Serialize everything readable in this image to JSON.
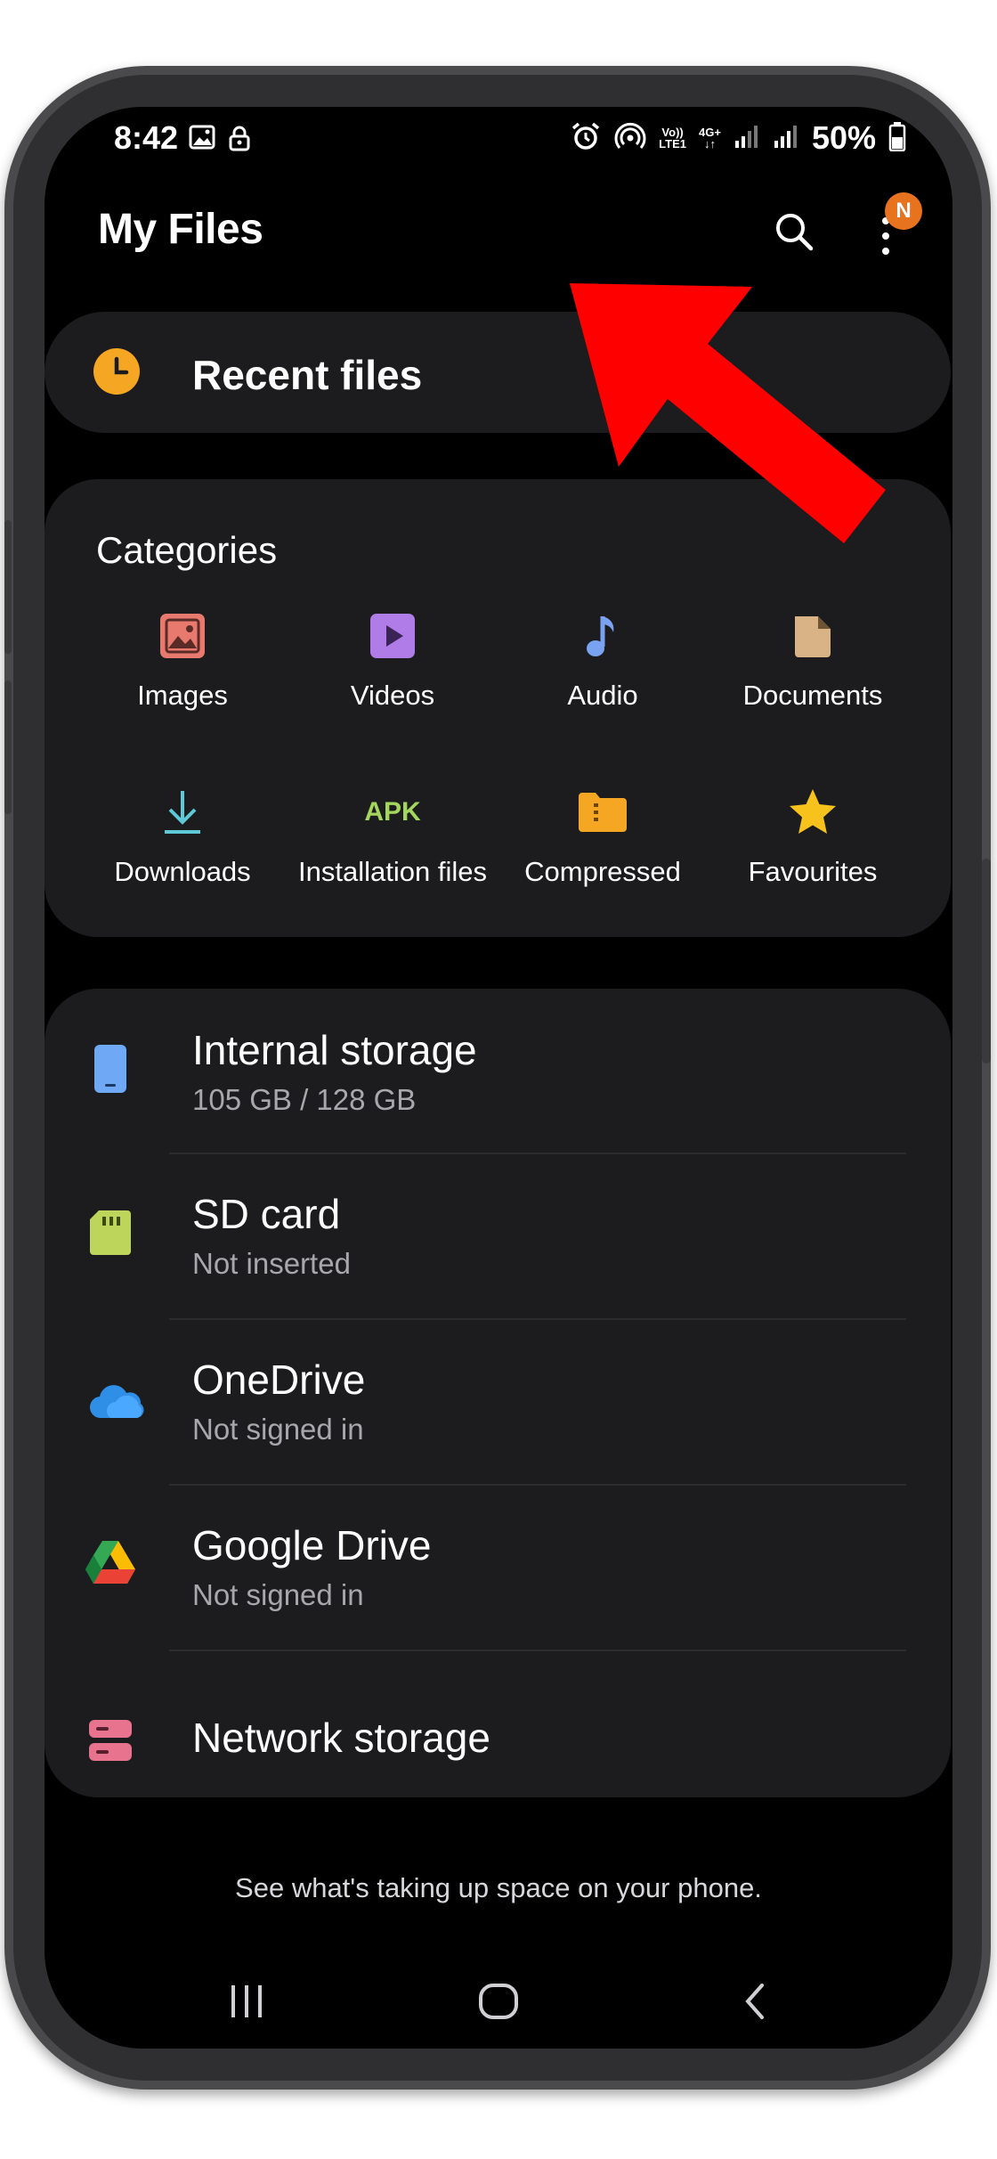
{
  "status_bar": {
    "time": "8:42",
    "battery": "50%",
    "volte_top": "Vo))",
    "volte_bottom": "LTE1",
    "net_top": "4G+",
    "net_bottom": "↓↑"
  },
  "header": {
    "title": "My Files",
    "badge": "N"
  },
  "recent": {
    "label": "Recent files"
  },
  "categories": {
    "title": "Categories",
    "items": [
      {
        "label": "Images",
        "icon": "image-icon",
        "color": "#e8796f"
      },
      {
        "label": "Videos",
        "icon": "video-icon",
        "color": "#b07ce8"
      },
      {
        "label": "Audio",
        "icon": "music-note-icon",
        "color": "#7aa2f2"
      },
      {
        "label": "Documents",
        "icon": "document-icon",
        "color": "#d9b386"
      },
      {
        "label": "Downloads",
        "icon": "download-icon",
        "color": "#5ec9d6"
      },
      {
        "label": "Installation files",
        "icon": "apk-icon",
        "icon_text": "APK",
        "color": "#a4d65e"
      },
      {
        "label": "Compressed",
        "icon": "archive-icon",
        "color": "#f5a623"
      },
      {
        "label": "Favourites",
        "icon": "star-icon",
        "color": "#f7c21b"
      }
    ]
  },
  "storage": {
    "items": [
      {
        "title": "Internal storage",
        "subtitle": "105 GB / 128 GB",
        "icon": "phone-icon",
        "color": "#6fa8f5"
      },
      {
        "title": "SD card",
        "subtitle": "Not inserted",
        "icon": "sd-card-icon",
        "color": "#bcd55a"
      },
      {
        "title": "OneDrive",
        "subtitle": "Not signed in",
        "icon": "onedrive-icon",
        "color": "#2f8fe6"
      },
      {
        "title": "Google Drive",
        "subtitle": "Not signed in",
        "icon": "google-drive-icon",
        "color": "#34a853"
      },
      {
        "title": "Network storage",
        "subtitle": "",
        "icon": "network-storage-icon",
        "color": "#e8738f"
      }
    ]
  },
  "footer": {
    "text": "See what's taking up space on your phone."
  },
  "colors": {
    "background": "#000000",
    "card": "#1c1c1e",
    "accent_orange": "#e8731f",
    "arrow_red": "#ff0000"
  }
}
